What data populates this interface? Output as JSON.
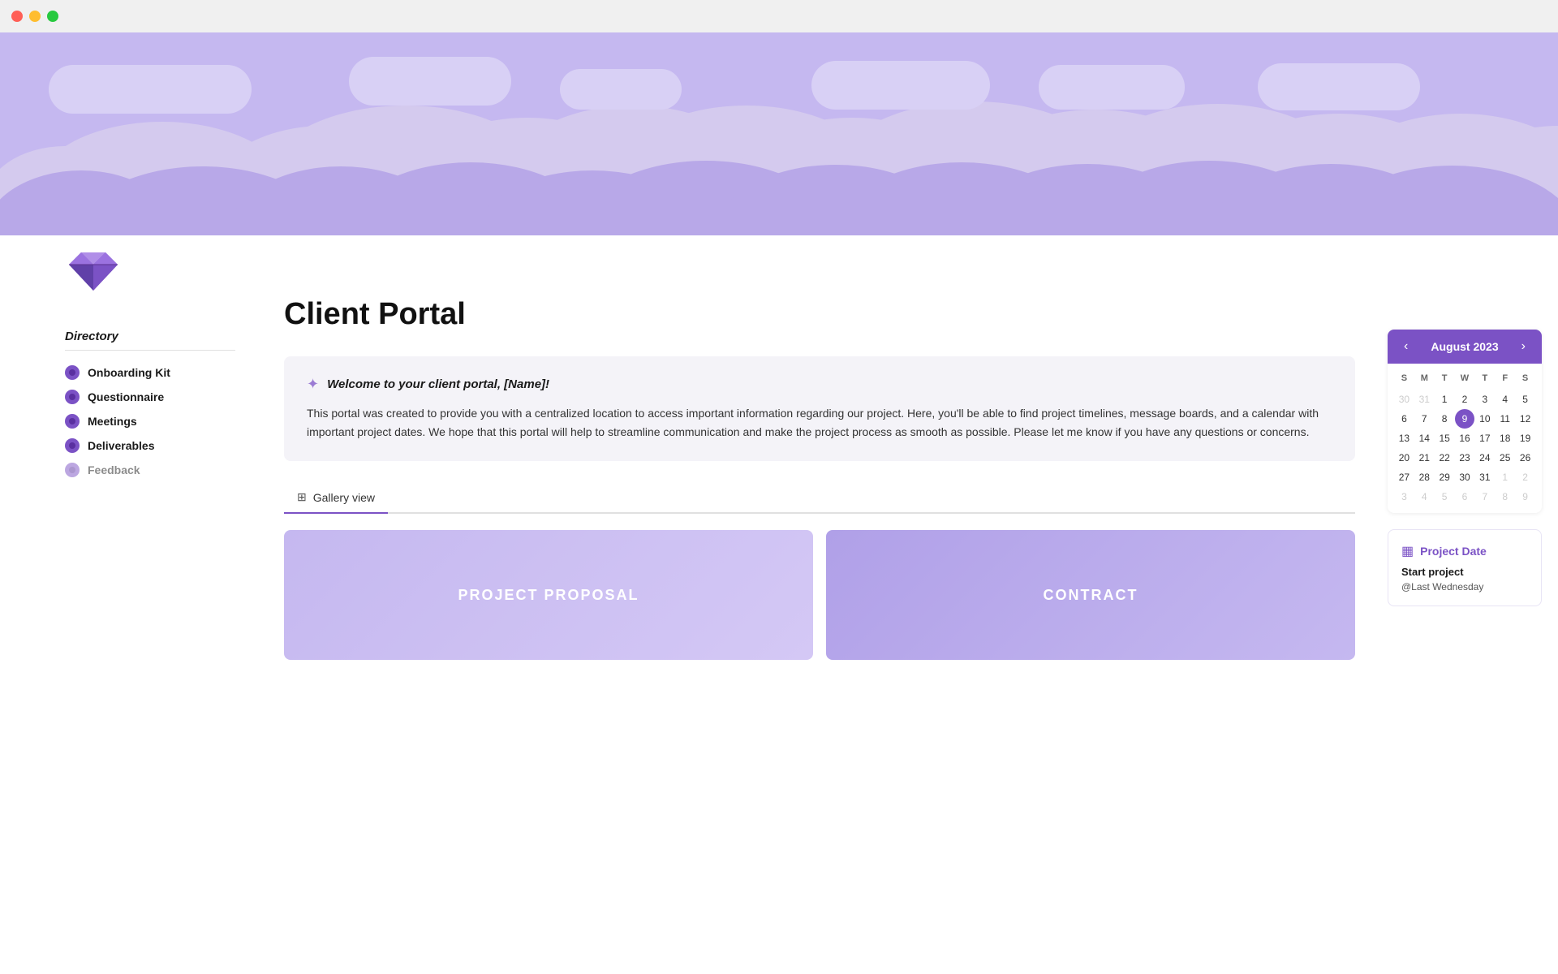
{
  "window": {
    "traffic_lights": [
      "red",
      "yellow",
      "green"
    ]
  },
  "hero": {
    "background_color": "#c5b8f0"
  },
  "diamond_icon": "♦",
  "page_title": "Client Portal",
  "welcome": {
    "icon": "☀",
    "title": "Welcome to your client portal, [Name]!",
    "body": "This portal was created to provide you with a centralized location to access important information regarding our project. Here, you'll be able to find project timelines, message boards, and a calendar with important project dates. We hope that this portal will help to streamline communication and make the project process as smooth as possible. Please let me know if you have any questions or concerns."
  },
  "gallery_tab": {
    "icon": "⊞",
    "label": "Gallery view"
  },
  "gallery_cards": [
    {
      "label": "PROJECT PROPOSAL",
      "color_class": "card-proposal"
    },
    {
      "label": "CONTRACT",
      "color_class": "card-contract"
    }
  ],
  "directory": {
    "title": "Directory",
    "items": [
      {
        "label": "Onboarding Kit"
      },
      {
        "label": "Questionnaire"
      },
      {
        "label": "Meetings"
      },
      {
        "label": "Deliverables"
      },
      {
        "label": "Feedback"
      }
    ]
  },
  "calendar": {
    "prev_label": "‹",
    "next_label": "›",
    "month_year": "August 2023",
    "day_names": [
      "S",
      "M",
      "T",
      "W",
      "T",
      "F",
      "S"
    ],
    "weeks": [
      [
        "30",
        "31",
        "1",
        "2",
        "3",
        "4",
        "5"
      ],
      [
        "6",
        "7",
        "8",
        "9",
        "10",
        "11",
        "12"
      ],
      [
        "13",
        "14",
        "15",
        "16",
        "17",
        "18",
        "19"
      ],
      [
        "20",
        "21",
        "22",
        "23",
        "24",
        "25",
        "26"
      ],
      [
        "27",
        "28",
        "29",
        "30",
        "31",
        "1",
        "2"
      ],
      [
        "3",
        "4",
        "5",
        "6",
        "7",
        "8",
        "9"
      ]
    ],
    "today": "9",
    "today_week": 1,
    "today_day_index": 3
  },
  "project_date": {
    "icon": "▦",
    "title": "Project Date",
    "label": "Start project",
    "value": "@Last Wednesday"
  }
}
